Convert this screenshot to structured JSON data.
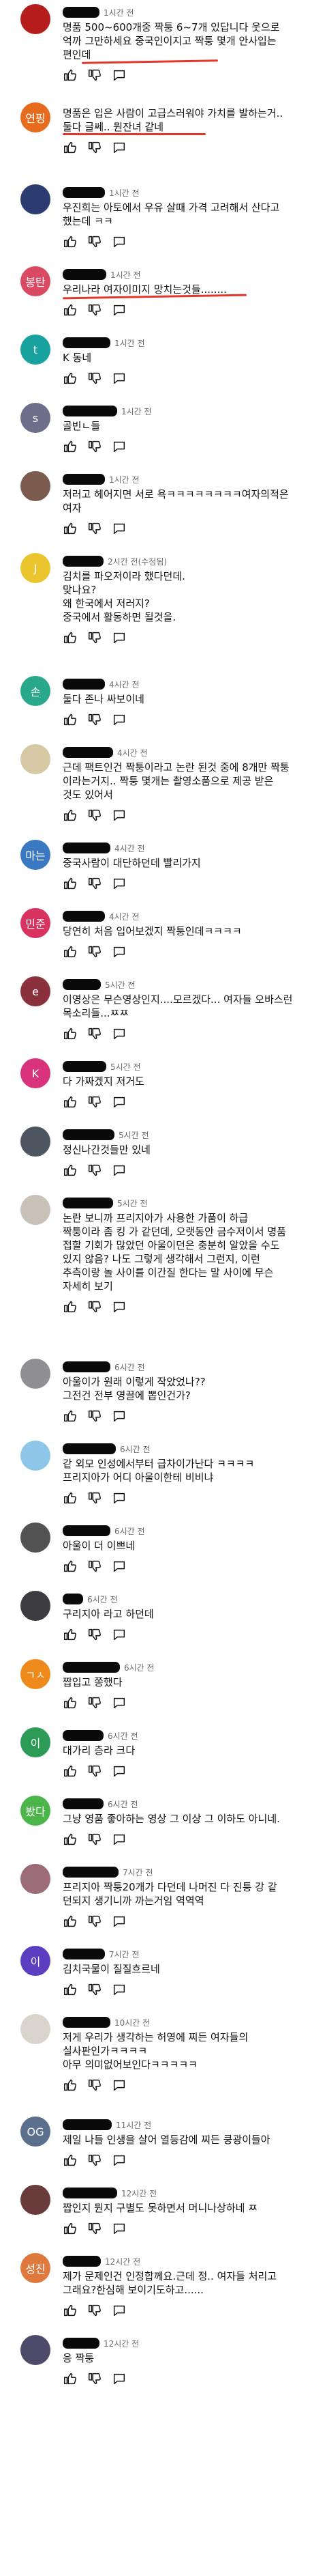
{
  "theme": {
    "redacted_color": "#0a0a0a",
    "annotation_color": "#e3372d",
    "meta_color": "#6b6b6b"
  },
  "comments": [
    {
      "avatar_color": "#b51d1d",
      "avatar_text": "",
      "time": "1시간 전",
      "text": "명품 500~600개중 짝퉁 6~7개 있답니다 웃으로\n억까 그만하세요 중국인이지고 짝퉁 몇개 안사입는\n편인데"
    },
    {
      "avatar_color": "#e66b1e",
      "avatar_text": "연핑",
      "time": "",
      "text": "명품은 입은 사람이 고급스러워야 가치를 발하는거..\n둘다 글쎄.. 뭔잔녀 같네"
    },
    {
      "avatar_color": "#2b3a6f",
      "avatar_text": "",
      "time": "1시간 전",
      "text": "우진희는 아토에서 우유 살때 가격 고려해서 산다고\n했는데 ㅋㅋ"
    },
    {
      "avatar_color": "#d94a62",
      "avatar_text": "봉탄",
      "time": "1시간 전",
      "text": "우리나라 여자이미지 망치는것들........"
    },
    {
      "avatar_color": "#17a2a0",
      "avatar_text": "t",
      "time": "1시간 전",
      "text": "K 동네"
    },
    {
      "avatar_color": "#6d6f8a",
      "avatar_text": "s",
      "time": "1시간 전",
      "text": "골빈ㄴ들"
    },
    {
      "avatar_color": "#7a5b4e",
      "avatar_text": "",
      "time": "1시간 전",
      "text": "저러고 헤어지면 서로 욕ㅋㅋㅋㅋㅋㅋㅋㅋ여자의적은\n여자"
    },
    {
      "avatar_color": "#ebc52d",
      "avatar_text": "J",
      "time": "2시간 전(수정됨)",
      "text": "김치를 파오저이라 했다던데.\n맞나요?\n왜 한국에서 저러지?\n중국에서 활동하면 될것을."
    },
    {
      "avatar_color": "#2aa88c",
      "avatar_text": "손",
      "time": "4시간 전",
      "text": "둘다 존나 싸보이네"
    },
    {
      "avatar_color": "#d8c9a6",
      "avatar_text": "",
      "time": "4시간 전",
      "text": "근데 팩트인건 짝퉁이라고 논란 된것 중에 8개만 짝퉁\n이라는거지.. 짝퉁 몇개는 촬영소품으로 제공 받은\n것도 있어서"
    },
    {
      "avatar_color": "#3a78c2",
      "avatar_text": "마는",
      "time": "4시간 전",
      "text": "중국사람이 대단하던데 빨리가지"
    },
    {
      "avatar_color": "#d8335f",
      "avatar_text": "민준",
      "time": "4시간 전",
      "text": "당연히 처음 입어보겠지 짝퉁인데ㅋㅋㅋㅋ"
    },
    {
      "avatar_color": "#8a2f3c",
      "avatar_text": "e",
      "time": "5시간 전",
      "text": "이영상은 무슨영상인지....모르겠다... 여자들 오바스런\n목소리들...ㅉㅉ"
    },
    {
      "avatar_color": "#d7327a",
      "avatar_text": "K",
      "time": "5시간 전",
      "text": "다 가짜겠지 저거도"
    },
    {
      "avatar_color": "#4c5560",
      "avatar_text": "",
      "time": "5시간 전",
      "text": "정신나간것들만 있네"
    },
    {
      "avatar_color": "#c7c1b8",
      "avatar_text": "",
      "time": "5시간 전",
      "text": "논란 보니까 프리지아가 사용한 가품이 하급\n짝퉁이라 좀 킹 가 같던데, 오랫동안 금수저이서 명품\n접할 기회가 많았던 아울이던은 충분히 알았을 수도\n있지 않음? 나도 그렇게 생각해서 그런지, 이런\n추측이랑 놀 사이를 이간질 한다는 말 사이에 무슨\n자세히 보기"
    },
    {
      "avatar_color": "#8e8e93",
      "avatar_text": "",
      "time": "6시간 전",
      "text": "아울이가 원래 이렇게 작았었나??\n그전건 전부 영끌에 뽑인건가?"
    },
    {
      "avatar_color": "#8ec6ea",
      "avatar_text": "",
      "time": "6시간 전",
      "text": "같 외모 인성에서부터 급차이가난다 ㅋㅋㅋㅋ\n프리지아가 어디 아울이한테 비비냐"
    },
    {
      "avatar_color": "#525252",
      "avatar_text": "",
      "time": "6시간 전",
      "text": "아울이 더 이쁘네"
    },
    {
      "avatar_color": "#3b3b40",
      "avatar_text": "",
      "time": "6시간 전",
      "text": "구리지아 라고 하던데"
    },
    {
      "avatar_color": "#ee8a1c",
      "avatar_text": "ㄱㅅ",
      "time": "6시간 전",
      "text": "짭입고 쫑했다"
    },
    {
      "avatar_color": "#2c9b55",
      "avatar_text": "이",
      "time": "6시간 전",
      "text": "대가리 층라 크다"
    },
    {
      "avatar_color": "#4bb54a",
      "avatar_text": "봤다",
      "time": "6시간 전",
      "text": "그냥 영품 좋아하는 영상 그 이상 그 이하도 아니네."
    },
    {
      "avatar_color": "#9b6b77",
      "avatar_text": "",
      "time": "7시간 전",
      "text": "프리지아 짝퉁20개가 다던데 나머진 다 진퉁 강 같\n던되지 생기니까 까는거임 역역역"
    },
    {
      "avatar_color": "#5b3fc0",
      "avatar_text": "이",
      "time": "7시간 전",
      "text": "김치국물이 질질흐르네"
    },
    {
      "avatar_color": "#d9d4cc",
      "avatar_text": "",
      "time": "10시간 전",
      "text": "저게 우리가 생각하는 허영에 찌든 여자들의\n실사판인가ㅋㅋㅋㅋ\n아무 의미없어보인다ㅋㅋㅋㅋㅋ"
    },
    {
      "avatar_color": "#5c6f8c",
      "avatar_text": "OG",
      "time": "11시간 전",
      "text": "제일 나들 인생을 살어 열등감에 찌든 쿵광이들아"
    },
    {
      "avatar_color": "#6a3b3b",
      "avatar_text": "",
      "time": "12시간 전",
      "text": "짭인지 뭔지 구별도 못하면서 머니나상하네 ㅉ"
    },
    {
      "avatar_color": "#e0793d",
      "avatar_text": "성진",
      "time": "12시간 전",
      "text": "제가 문제인건 인정합께요.근데 정.. 여자들 처리고\n그래요?한심해 보이기도하고......"
    },
    {
      "avatar_color": "#4d4a6a",
      "avatar_text": "",
      "time": "12시간 전",
      "text": "응 짝퉁"
    }
  ]
}
